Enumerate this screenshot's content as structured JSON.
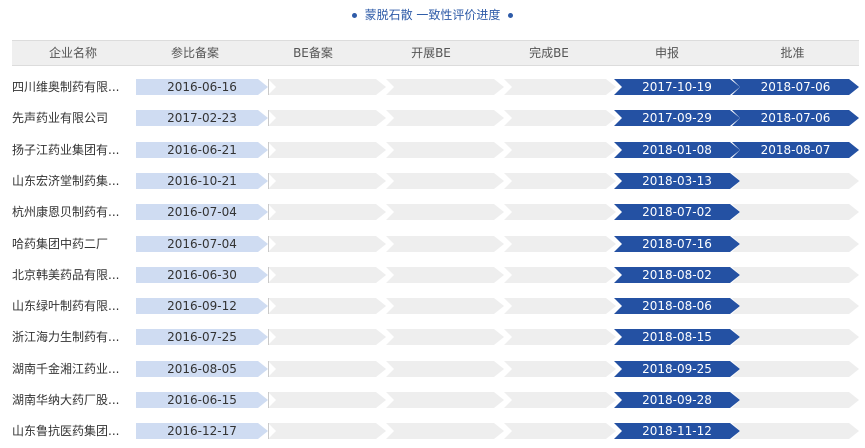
{
  "title": "蒙脱石散 一致性评价进度",
  "columns": [
    "企业名称",
    "参比备案",
    "BE备案",
    "开展BE",
    "完成BE",
    "申报",
    "批准"
  ],
  "rows": [
    {
      "company": "四川维奥制药有限...",
      "ref_filing": "2016-06-16",
      "submit": "2017-10-19",
      "approve": "2018-07-06"
    },
    {
      "company": "先声药业有限公司",
      "ref_filing": "2017-02-23",
      "submit": "2017-09-29",
      "approve": "2018-07-06"
    },
    {
      "company": "扬子江药业集团有...",
      "ref_filing": "2016-06-21",
      "submit": "2018-01-08",
      "approve": "2018-08-07"
    },
    {
      "company": "山东宏济堂制药集...",
      "ref_filing": "2016-10-21",
      "submit": "2018-03-13",
      "approve": ""
    },
    {
      "company": "杭州康恩贝制药有...",
      "ref_filing": "2016-07-04",
      "submit": "2018-07-02",
      "approve": ""
    },
    {
      "company": "哈药集团中药二厂",
      "ref_filing": "2016-07-04",
      "submit": "2018-07-16",
      "approve": ""
    },
    {
      "company": "北京韩美药品有限...",
      "ref_filing": "2016-06-30",
      "submit": "2018-08-02",
      "approve": ""
    },
    {
      "company": "山东绿叶制药有限...",
      "ref_filing": "2016-09-12",
      "submit": "2018-08-06",
      "approve": ""
    },
    {
      "company": "浙江海力生制药有...",
      "ref_filing": "2016-07-25",
      "submit": "2018-08-15",
      "approve": ""
    },
    {
      "company": "湖南千金湘江药业...",
      "ref_filing": "2016-08-05",
      "submit": "2018-09-25",
      "approve": ""
    },
    {
      "company": "湖南华纳大药厂股...",
      "ref_filing": "2016-06-15",
      "submit": "2018-09-28",
      "approve": ""
    },
    {
      "company": "山东鲁抗医药集团...",
      "ref_filing": "2016-12-17",
      "submit": "2018-11-12",
      "approve": ""
    }
  ]
}
